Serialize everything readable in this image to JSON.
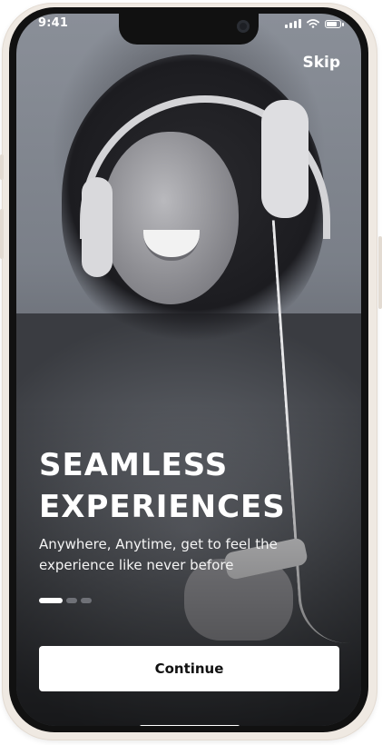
{
  "status_bar": {
    "time": "9:41",
    "icons": [
      "signal-icon",
      "wifi-icon",
      "battery-icon"
    ]
  },
  "header": {
    "skip_label": "Skip"
  },
  "hero": {
    "title_line1": "SEAMLESS",
    "title_line2": "EXPERIENCES",
    "subtitle": "Anywhere, Anytime, get to feel the experience like never before",
    "image_subject": "woman-with-headphones"
  },
  "pagination": {
    "total": 3,
    "active_index": 0
  },
  "cta": {
    "label": "Continue"
  },
  "colors": {
    "cta_background": "#ffffff",
    "text_on_image": "#ffffff",
    "device_frame": "#efe9e2"
  }
}
